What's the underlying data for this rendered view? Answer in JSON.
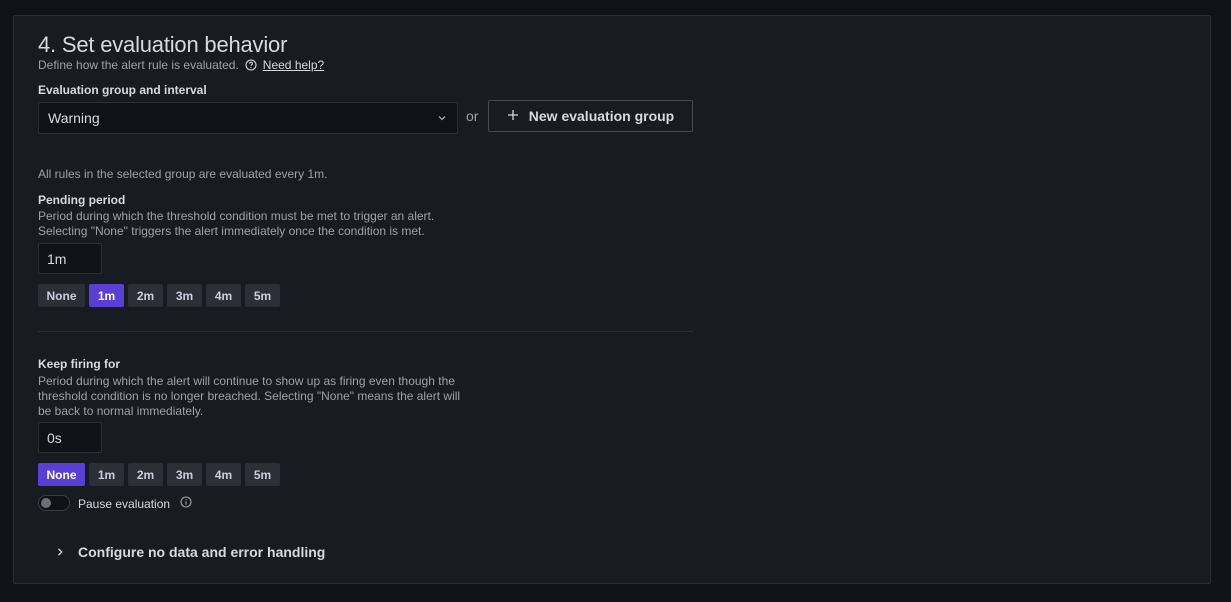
{
  "section": {
    "title": "4. Set evaluation behavior",
    "subtitle": "Define how the alert rule is evaluated.",
    "help_link": "Need help?"
  },
  "eval_group": {
    "label": "Evaluation group and interval",
    "selected": "Warning",
    "or_text": "or",
    "new_button": "New evaluation group",
    "info": "All rules in the selected group are evaluated every 1m."
  },
  "pending": {
    "label": "Pending period",
    "desc1": "Period during which the threshold condition must be met to trigger an alert.",
    "desc2": "Selecting \"None\" triggers the alert immediately once the condition is met.",
    "value": "1m",
    "presets": [
      "None",
      "1m",
      "2m",
      "3m",
      "4m",
      "5m"
    ],
    "active": "1m"
  },
  "keep_firing": {
    "label": "Keep firing for",
    "desc1": "Period during which the alert will continue to show up as firing even though the",
    "desc2": "threshold condition is no longer breached. Selecting \"None\" means the alert will",
    "desc3": "be back to normal immediately.",
    "value": "0s",
    "presets": [
      "None",
      "1m",
      "2m",
      "3m",
      "4m",
      "5m"
    ],
    "active": "None"
  },
  "pause": {
    "label": "Pause evaluation",
    "enabled": false
  },
  "configure": {
    "label": "Configure no data and error handling"
  },
  "colors": {
    "accent": "#5a3fd6",
    "background": "#111217",
    "panel": "#181b1f"
  }
}
